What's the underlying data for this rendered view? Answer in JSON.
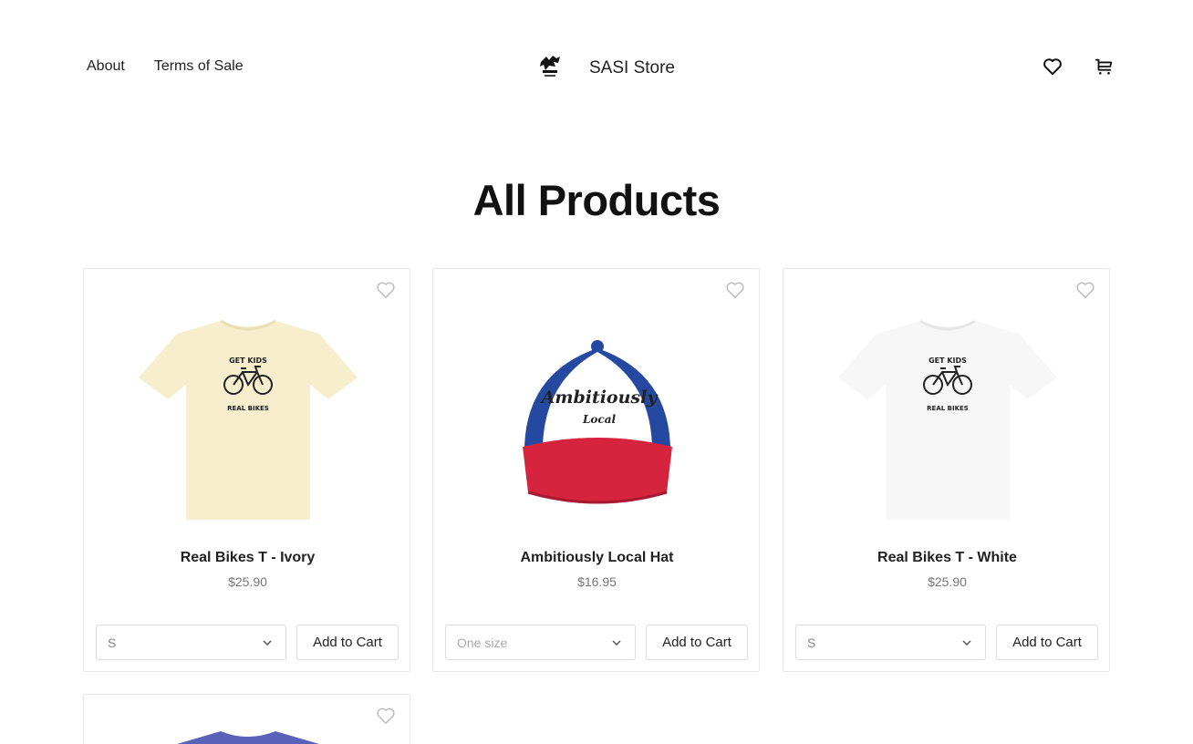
{
  "header": {
    "nav": [
      {
        "label": "About"
      },
      {
        "label": "Terms of Sale"
      }
    ],
    "brand": {
      "name": "SASI Store",
      "logo_icon": "sasi-logo-icon"
    },
    "icons": [
      "heart-icon",
      "cart-icon"
    ]
  },
  "page": {
    "title": "All Products"
  },
  "products": [
    {
      "name": "Real Bikes T - Ivory",
      "price": "$25.90",
      "size_value": "S",
      "add_label": "Add to Cart",
      "image_icon": "ivory-tshirt-image",
      "color": "#f6eecd",
      "print_top": "GET KIDS",
      "print_bottom": "REAL BIKES"
    },
    {
      "name": "Ambitiously Local Hat",
      "price": "$16.95",
      "size_value": "One size",
      "add_label": "Add to Cart",
      "image_icon": "trucker-hat-image",
      "hat_text_1": "Ambitiously",
      "hat_text_2": "Local"
    },
    {
      "name": "Real Bikes T - White",
      "price": "$25.90",
      "size_value": "S",
      "add_label": "Add to Cart",
      "image_icon": "white-tshirt-image",
      "color": "#f7f7f7",
      "print_top": "GET KIDS",
      "print_bottom": "REAL BIKES"
    },
    {
      "name": "",
      "price": "",
      "image_icon": "blue-tshirt-image",
      "color": "#5862b8"
    }
  ],
  "colors": {
    "hat_blue": "#2548a0",
    "hat_red": "#d6243f",
    "text": "#222222",
    "price": "#777777"
  }
}
